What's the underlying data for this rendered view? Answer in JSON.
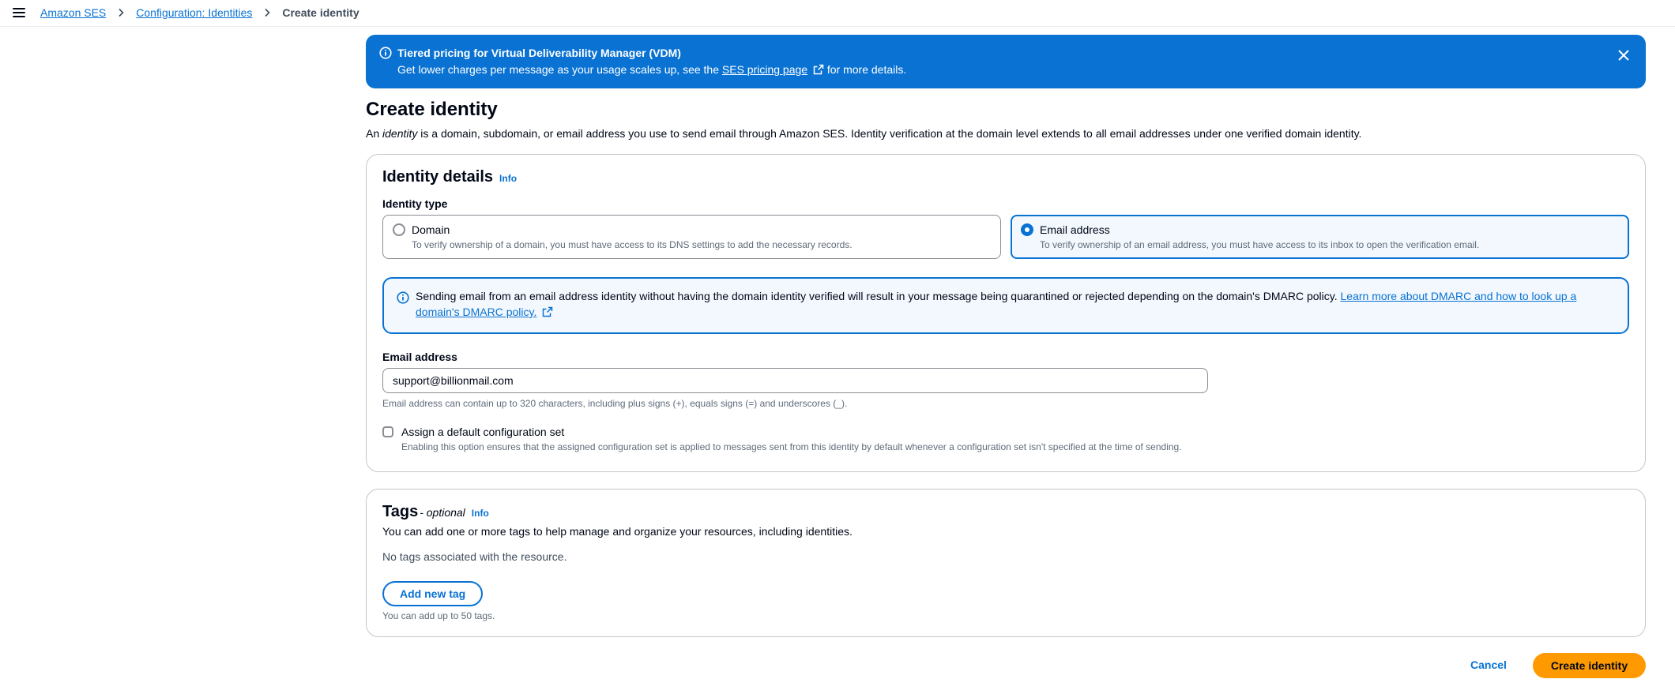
{
  "breadcrumb": {
    "items": [
      "Amazon SES",
      "Configuration: Identities"
    ],
    "current": "Create identity"
  },
  "banner": {
    "title": "Tiered pricing for Virtual Deliverability Manager (VDM)",
    "text_before": "Get lower charges per message as your usage scales up, see the ",
    "link": "SES pricing page",
    "text_after": " for more details."
  },
  "page": {
    "title": "Create identity",
    "desc_prefix": "An ",
    "desc_italic": "identity",
    "desc_suffix": " is a domain, subdomain, or email address you use to send email through Amazon SES. Identity verification at the domain level extends to all email addresses under one verified domain identity."
  },
  "identity_details": {
    "title": "Identity details",
    "info": "Info",
    "type_label": "Identity type",
    "options": [
      {
        "label": "Domain",
        "desc": "To verify ownership of a domain, you must have access to its DNS settings to add the necessary records.",
        "selected": false
      },
      {
        "label": "Email address",
        "desc": "To verify ownership of an email address, you must have access to its inbox to open the verification email.",
        "selected": true
      }
    ],
    "alert_text": "Sending email from an email address identity without having the domain identity verified will result in your message being quarantined or rejected depending on the domain's DMARC policy. ",
    "alert_link": "Learn more about DMARC and how to look up a domain's DMARC policy.",
    "email_label": "Email address",
    "email_value": "support@billionmail.com",
    "email_hint": "Email address can contain up to 320 characters, including plus signs (+), equals signs (=) and underscores (_).",
    "config_label": "Assign a default configuration set",
    "config_hint": "Enabling this option ensures that the assigned configuration set is applied to messages sent from this identity by default whenever a configuration set isn't specified at the time of sending."
  },
  "tags": {
    "title": "Tags",
    "optional": "- optional",
    "info": "Info",
    "desc": "You can add one or more tags to help manage and organize your resources, including identities.",
    "empty": "No tags associated with the resource.",
    "add_button": "Add new tag",
    "limit": "You can add up to 50 tags."
  },
  "footer": {
    "cancel": "Cancel",
    "submit": "Create identity"
  },
  "colors": {
    "primary": "#0972d3",
    "accent": "#ff9900",
    "text": "#000716",
    "muted": "#5f6b7a"
  }
}
